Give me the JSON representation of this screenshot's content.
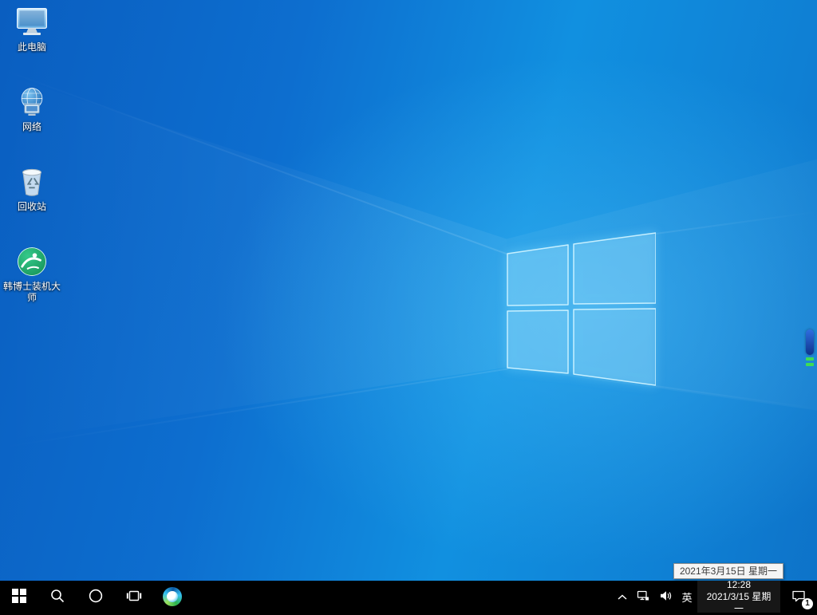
{
  "desktop": {
    "icons": [
      {
        "id": "this-pc",
        "label": "此电脑",
        "icon": "computer-icon"
      },
      {
        "id": "network",
        "label": "网络",
        "icon": "network-globe-icon"
      },
      {
        "id": "recycle-bin",
        "label": "回收站",
        "icon": "recycle-bin-icon"
      },
      {
        "id": "hanboshi-installer",
        "label": "韩博士装机大师",
        "icon": "hanboshi-green-icon"
      }
    ],
    "side_indicator": {
      "icon": "volume-level-indicator"
    }
  },
  "taskbar": {
    "left": [
      {
        "id": "start",
        "icon": "windows-start-icon"
      },
      {
        "id": "search",
        "icon": "search-icon"
      },
      {
        "id": "cortana",
        "icon": "cortana-circle-icon"
      },
      {
        "id": "task-view",
        "icon": "task-view-icon"
      },
      {
        "id": "edge",
        "icon": "edge-browser-icon"
      }
    ],
    "tray": {
      "chevron_icon": "chevron-up-icon",
      "network_icon": "network-tray-icon",
      "volume_icon": "speaker-icon",
      "ime_label": "英",
      "clock": {
        "time": "12:28",
        "date": "2021/3/15 星期一"
      },
      "action_center": {
        "icon": "action-center-icon",
        "badge": "1"
      }
    }
  },
  "tooltip": {
    "text": "2021年3月15日 星期一"
  },
  "colors": {
    "taskbar_bg": "#000000",
    "desktop_blue": "#0f7ad2",
    "logo_glow": "#aee6ff",
    "tooltip_bg": "#f5f5f5",
    "hanboshi_green": "#1ca86a",
    "indicator_green": "#3edc54",
    "indicator_blue": "#1e4fd0"
  }
}
